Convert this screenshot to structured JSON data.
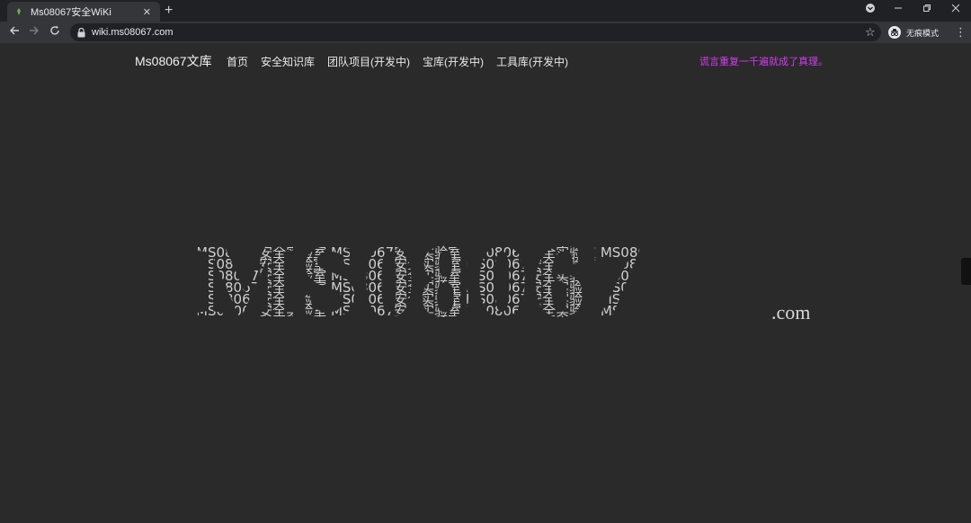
{
  "browser": {
    "tab_title": "Ms08067安全WiKi",
    "tab_close": "✕",
    "new_tab": "+",
    "url": "wiki.ms08067.com",
    "incognito_label": "无痕模式"
  },
  "site": {
    "brand": "Ms08067文库",
    "nav": [
      "首页",
      "安全知识库",
      "团队项目(开发中)",
      "宝库(开发中)",
      "工具库(开发中)"
    ],
    "slogan": "谎言重复一千遍就成了真理。"
  },
  "hero": {
    "logo_text": "MS08067",
    "texture_text": "MS08067安全实验室",
    "suffix": ".com"
  },
  "colors": {
    "page_bg": "#2a2a2a",
    "slogan": "#d33cf0",
    "logo_texture": "#cfcfcf"
  }
}
